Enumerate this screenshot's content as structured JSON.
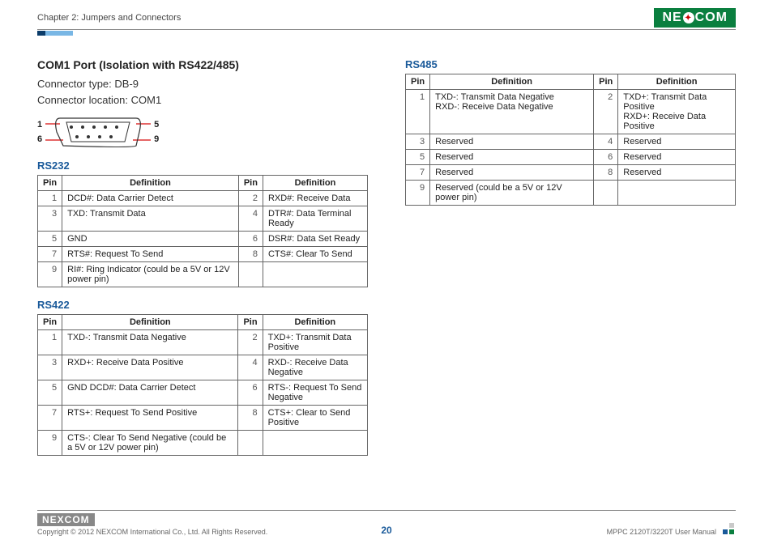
{
  "header": {
    "chapter": "Chapter 2: Jumpers and Connectors",
    "brand": "NEXCOM"
  },
  "main": {
    "title": "COM1 Port (Isolation with RS422/485)",
    "connector_type": "Connector type: DB-9",
    "connector_location": "Connector location: COM1",
    "pinlabels": {
      "p1": "1",
      "p5": "5",
      "p6": "6",
      "p9": "9"
    }
  },
  "tables": {
    "headers": {
      "pin": "Pin",
      "def": "Definition"
    },
    "rs232": {
      "title": "RS232",
      "rows": [
        {
          "a_pin": "1",
          "a_def": "DCD#: Data Carrier Detect",
          "b_pin": "2",
          "b_def": "RXD#: Receive Data"
        },
        {
          "a_pin": "3",
          "a_def": "TXD: Transmit Data",
          "b_pin": "4",
          "b_def": "DTR#: Data Terminal Ready"
        },
        {
          "a_pin": "5",
          "a_def": "GND",
          "b_pin": "6",
          "b_def": "DSR#: Data Set Ready"
        },
        {
          "a_pin": "7",
          "a_def": "RTS#: Request To Send",
          "b_pin": "8",
          "b_def": "CTS#: Clear To Send"
        },
        {
          "a_pin": "9",
          "a_def": "RI#: Ring Indicator (could be a 5V or 12V power pin)",
          "b_pin": "",
          "b_def": ""
        }
      ]
    },
    "rs422": {
      "title": "RS422",
      "rows": [
        {
          "a_pin": "1",
          "a_def": "TXD-: Transmit Data Negative",
          "b_pin": "2",
          "b_def": "TXD+: Transmit Data Positive"
        },
        {
          "a_pin": "3",
          "a_def": "RXD+: Receive Data Positive",
          "b_pin": "4",
          "b_def": "RXD-: Receive Data Negative"
        },
        {
          "a_pin": "5",
          "a_def": "GND DCD#: Data Carrier Detect",
          "b_pin": "6",
          "b_def": "RTS-: Request To Send Negative"
        },
        {
          "a_pin": "7",
          "a_def": "RTS+: Request To Send Positive",
          "b_pin": "8",
          "b_def": "CTS+: Clear to Send Positive"
        },
        {
          "a_pin": "9",
          "a_def": "CTS-: Clear To Send Negative (could be a 5V or 12V power pin)",
          "b_pin": "",
          "b_def": ""
        }
      ]
    },
    "rs485": {
      "title": "RS485",
      "rows": [
        {
          "a_pin": "1",
          "a_def": "TXD-: Transmit Data Negative\nRXD-: Receive Data Negative",
          "b_pin": "2",
          "b_def": "TXD+: Transmit Data Positive\nRXD+: Receive Data Positive"
        },
        {
          "a_pin": "3",
          "a_def": "Reserved",
          "b_pin": "4",
          "b_def": "Reserved"
        },
        {
          "a_pin": "5",
          "a_def": "Reserved",
          "b_pin": "6",
          "b_def": "Reserved"
        },
        {
          "a_pin": "7",
          "a_def": "Reserved",
          "b_pin": "8",
          "b_def": "Reserved"
        },
        {
          "a_pin": "9",
          "a_def": "Reserved (could be a 5V or 12V power pin)",
          "b_pin": "",
          "b_def": ""
        }
      ]
    }
  },
  "footer": {
    "brand": "NEXCOM",
    "copyright": "Copyright © 2012 NEXCOM International Co., Ltd. All Rights Reserved.",
    "page": "20",
    "manual": "MPPC 2120T/3220T User Manual"
  }
}
